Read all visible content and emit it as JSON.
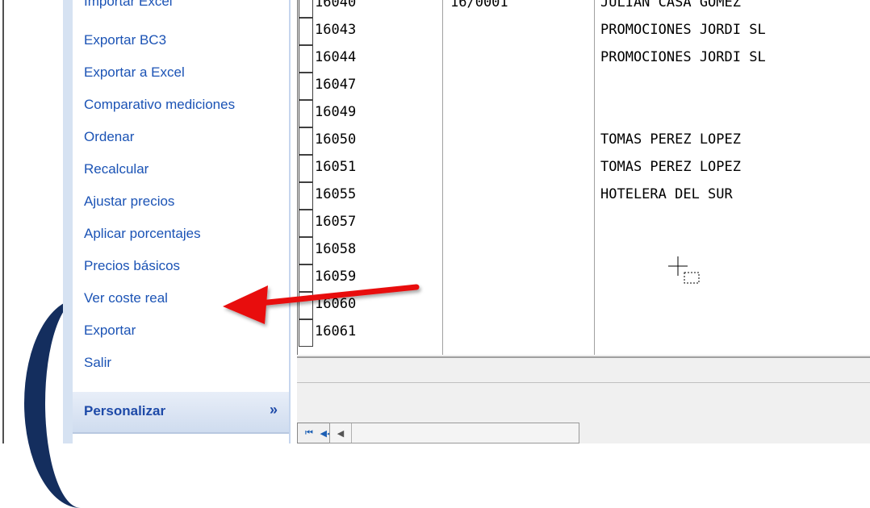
{
  "task_panel": {
    "items": [
      {
        "label": "Importar Excel",
        "name": "menu-importar-excel"
      },
      {
        "label": "Exportar BC3",
        "name": "menu-exportar-bc3"
      },
      {
        "label": "Exportar a Excel",
        "name": "menu-exportar-a-excel"
      },
      {
        "label": "Comparativo mediciones",
        "name": "menu-comparativo-mediciones"
      },
      {
        "label": "Ordenar",
        "name": "menu-ordenar"
      },
      {
        "label": "Recalcular",
        "name": "menu-recalcular"
      },
      {
        "label": "Ajustar precios",
        "name": "menu-ajustar-precios"
      },
      {
        "label": "Aplicar porcentajes",
        "name": "menu-aplicar-porcentajes"
      },
      {
        "label": "Precios básicos",
        "name": "menu-precios-basicos"
      },
      {
        "label": "Ver coste real",
        "name": "menu-ver-coste-real"
      },
      {
        "label": "Exportar",
        "name": "menu-exportar"
      },
      {
        "label": "Salir",
        "name": "menu-salir"
      }
    ],
    "section_title": "Personalizar",
    "section_chevron": "»"
  },
  "grid": {
    "rows": [
      {
        "code": "16040",
        "ref": "16/0001",
        "client": "JULIAN CASA GOMEZ"
      },
      {
        "code": "16043",
        "ref": "",
        "client": "PROMOCIONES JORDI SL"
      },
      {
        "code": "16044",
        "ref": "",
        "client": "PROMOCIONES JORDI SL"
      },
      {
        "code": "16047",
        "ref": "",
        "client": ""
      },
      {
        "code": "16049",
        "ref": "",
        "client": ""
      },
      {
        "code": "16050",
        "ref": "",
        "client": "TOMAS PEREZ LOPEZ"
      },
      {
        "code": "16051",
        "ref": "",
        "client": "TOMAS PEREZ LOPEZ"
      },
      {
        "code": "16055",
        "ref": "",
        "client": "HOTELERA DEL SUR"
      },
      {
        "code": "16057",
        "ref": "",
        "client": ""
      },
      {
        "code": "16058",
        "ref": "",
        "client": ""
      },
      {
        "code": "16059",
        "ref": "",
        "client": ""
      },
      {
        "code": "16060",
        "ref": "",
        "client": ""
      },
      {
        "code": "16061",
        "ref": "",
        "client": ""
      }
    ]
  },
  "navigator": {
    "buttons": [
      {
        "name": "nav-first-button",
        "glyph": "⏮",
        "style": "blue"
      },
      {
        "name": "nav-prior-page-button",
        "glyph": "◀◀",
        "style": "blue"
      },
      {
        "name": "nav-prior-button",
        "glyph": "◀",
        "style": "blue"
      },
      {
        "name": "nav-next-button",
        "glyph": "▶",
        "style": ""
      },
      {
        "name": "nav-next-page-button",
        "glyph": "▶▶",
        "style": ""
      },
      {
        "name": "nav-last-button",
        "glyph": "⏭",
        "style": ""
      },
      {
        "name": "nav-refresh-button",
        "glyph": "↻",
        "style": "blue"
      },
      {
        "name": "nav-insert-button",
        "glyph": "✱",
        "style": ""
      },
      {
        "name": "nav-cancel-button",
        "glyph": "✲",
        "style": "disabled"
      },
      {
        "name": "nav-filter-button",
        "glyph": "▽",
        "style": ""
      }
    ]
  },
  "colors": {
    "link": "#1b53b5",
    "arrow": "#e81010",
    "panel_header": "#1e4aa8"
  }
}
